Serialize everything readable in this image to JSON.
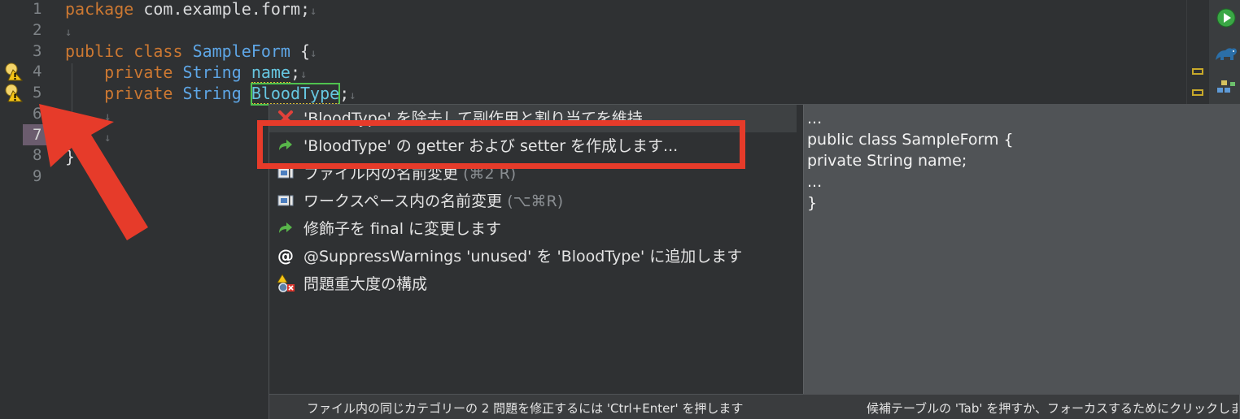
{
  "editor": {
    "line_numbers": [
      "1",
      "2",
      "3",
      "4",
      "5",
      "6",
      "7",
      "8",
      "9"
    ],
    "lines": {
      "l1": {
        "kw": "package",
        "rest": " com.example.form;"
      },
      "l3": {
        "kw1": "public",
        "kw2": "class",
        "cls": "SampleForm",
        "rest": " {"
      },
      "l4": {
        "kw": "private",
        "type": "String",
        "field": "name",
        "end": ";"
      },
      "l5": {
        "kw": "private",
        "type": "String",
        "field": "BloodType",
        "end": ";"
      },
      "l8": {
        "text": "}"
      }
    },
    "return_glyph": "↓"
  },
  "quickfix": {
    "items": [
      {
        "label": "'BloodType' を除去して副作用と割り当てを維持",
        "shortcut": "",
        "icon": "remove-icon"
      },
      {
        "label": "'BloodType' の getter および setter を作成します...",
        "shortcut": "",
        "icon": "green-arrow-icon"
      },
      {
        "label": "ファイル内の名前変更",
        "shortcut": "(⌘2 R)",
        "icon": "rename-icon"
      },
      {
        "label": "ワークスペース内の名前変更",
        "shortcut": "(⌥⌘R)",
        "icon": "rename-icon"
      },
      {
        "label": "修飾子を final に変更します",
        "shortcut": "",
        "icon": "green-arrow-icon"
      },
      {
        "label": "@SuppressWarnings 'unused' を 'BloodType' に追加します",
        "shortcut": "",
        "icon": "annotation-icon"
      },
      {
        "label": "問題重大度の構成",
        "shortcut": "",
        "icon": "configure-severity-icon"
      }
    ],
    "preview_lines": [
      "...",
      "public class SampleForm {",
      "private String name;",
      "...",
      "}"
    ],
    "status_left": "ファイル内の同じカテゴリーの 2 問題を修正するには  'Ctrl+Enter'  を押します",
    "status_right": "候補テーブルの 'Tab' を押すか、フォーカスするためにクリックします"
  },
  "colors": {
    "background": "#2f3133",
    "keyword": "#cc7832",
    "class_name": "#5ea6e6",
    "annotation_red": "#e63b2a",
    "selection_green": "#4fc24f",
    "warning_yellow": "#d4b832"
  }
}
